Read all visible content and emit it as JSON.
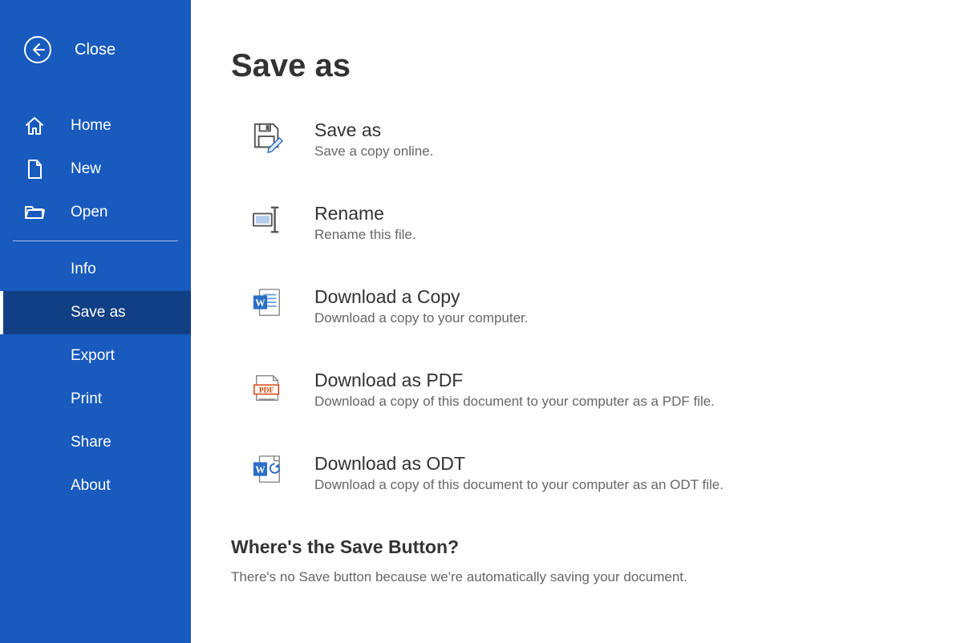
{
  "colors": {
    "accent": "#185abd",
    "dark": "#103f83"
  },
  "sidebar": {
    "close_label": "Close",
    "primary": [
      {
        "id": "home",
        "label": "Home",
        "icon": "home-icon"
      },
      {
        "id": "new",
        "label": "New",
        "icon": "document-icon"
      },
      {
        "id": "open",
        "label": "Open",
        "icon": "folder-open-icon"
      }
    ],
    "secondary": [
      {
        "id": "info",
        "label": "Info",
        "selected": false
      },
      {
        "id": "saveas",
        "label": "Save as",
        "selected": true
      },
      {
        "id": "export",
        "label": "Export",
        "selected": false
      },
      {
        "id": "print",
        "label": "Print",
        "selected": false
      },
      {
        "id": "share",
        "label": "Share",
        "selected": false
      },
      {
        "id": "about",
        "label": "About",
        "selected": false
      }
    ]
  },
  "page": {
    "title": "Save as",
    "options": [
      {
        "id": "saveas",
        "icon": "disk-pencil-icon",
        "title": "Save as",
        "desc": "Save a copy online."
      },
      {
        "id": "rename",
        "icon": "rename-icon",
        "title": "Rename",
        "desc": "Rename this file."
      },
      {
        "id": "dlcopy",
        "icon": "word-doc-icon",
        "title": "Download a Copy",
        "desc": "Download a copy to your computer."
      },
      {
        "id": "dlpdf",
        "icon": "pdf-icon",
        "title": "Download as PDF",
        "desc": "Download a copy of this document to your computer as a PDF file."
      },
      {
        "id": "dlodt",
        "icon": "word-convert-icon",
        "title": "Download as ODT",
        "desc": "Download a copy of this document to your computer as an ODT file."
      }
    ],
    "footer": {
      "title": "Where's the Save Button?",
      "text": "There's no Save button because we're automatically saving your document."
    }
  }
}
